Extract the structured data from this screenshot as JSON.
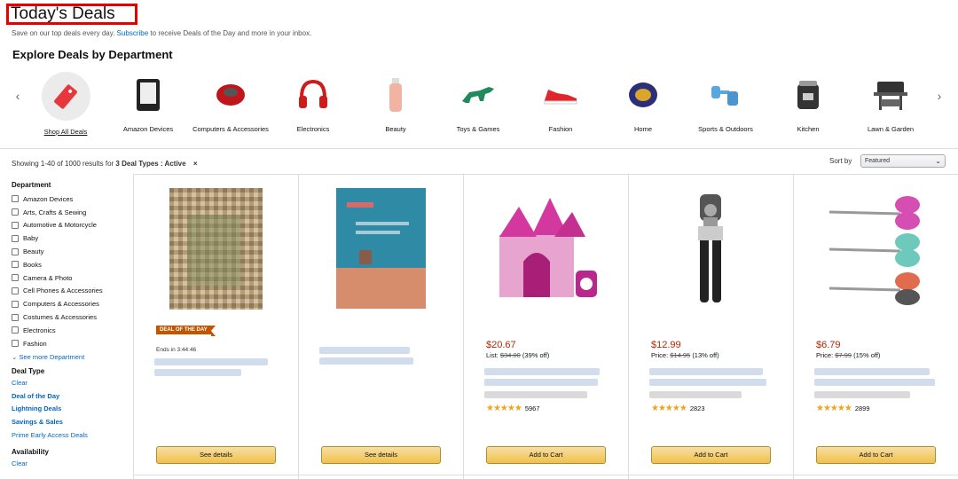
{
  "header": {
    "title": "Today's Deals",
    "subtitle_pre": "Save on our top deals every day.",
    "subtitle_link": "Subscribe",
    "subtitle_post": "to receive Deals of the Day and more in your inbox.",
    "explore": "Explore Deals by Department"
  },
  "departments": [
    {
      "label": "Shop All Deals",
      "icon": "tag-icon"
    },
    {
      "label": "Amazon Devices",
      "icon": "kindle-icon"
    },
    {
      "label": "Computers & Accessories",
      "icon": "mouse-icon"
    },
    {
      "label": "Electronics",
      "icon": "headphones-icon"
    },
    {
      "label": "Beauty",
      "icon": "bottle-icon"
    },
    {
      "label": "Toys & Games",
      "icon": "dinosaur-icon"
    },
    {
      "label": "Fashion",
      "icon": "shoe-icon"
    },
    {
      "label": "Home",
      "icon": "candle-icon"
    },
    {
      "label": "Sports & Outdoors",
      "icon": "dumbbell-icon"
    },
    {
      "label": "Kitchen",
      "icon": "pressure-cooker-icon"
    },
    {
      "label": "Lawn & Garden",
      "icon": "grill-icon"
    }
  ],
  "results": {
    "showing": "Showing 1-40 of 1000 results for",
    "filter": "3 Deal Types : Active",
    "clear_x": "×",
    "sort_label": "Sort by",
    "sort_value": "Featured"
  },
  "sidebar": {
    "department_heading": "Department",
    "departments": [
      "Amazon Devices",
      "Arts, Crafts & Sewing",
      "Automotive & Motorcycle",
      "Baby",
      "Beauty",
      "Books",
      "Camera & Photo",
      "Cell Phones & Accessories",
      "Computers & Accessories",
      "Costumes & Accessories",
      "Electronics",
      "Fashion"
    ],
    "see_more": "See more Department",
    "deal_type_heading": "Deal Type",
    "clear": "Clear",
    "deal_types": [
      "Deal of the Day",
      "Lightning Deals",
      "Savings & Sales"
    ],
    "prime_early": "Prime Early Access Deals",
    "availability_heading": "Availability",
    "clear2": "Clear"
  },
  "products": [
    {
      "badge": "DEAL OF THE DAY",
      "ends": "Ends in 3:44:46",
      "button": "See details"
    },
    {
      "button": "See details"
    },
    {
      "price": "$20.67",
      "list_label": "List:",
      "list_price": "$34.00",
      "discount": "(39% off)",
      "rating": 4.5,
      "reviews": "5967",
      "button": "Add to Cart"
    },
    {
      "price": "$12.99",
      "list_label": "Price:",
      "list_price": "$14.95",
      "discount": "(13% off)",
      "rating": 4.5,
      "reviews": "2823",
      "button": "Add to Cart"
    },
    {
      "price": "$6.79",
      "list_label": "Price:",
      "list_price": "$7.99",
      "discount": "(15% off)",
      "rating": 5,
      "reviews": "2899",
      "button": "Add to Cart"
    }
  ],
  "colors": {
    "title_box": "#e60000",
    "price": "#b12704",
    "link": "#0066c0",
    "button": "#f0c14b",
    "badge": "#c45500"
  }
}
